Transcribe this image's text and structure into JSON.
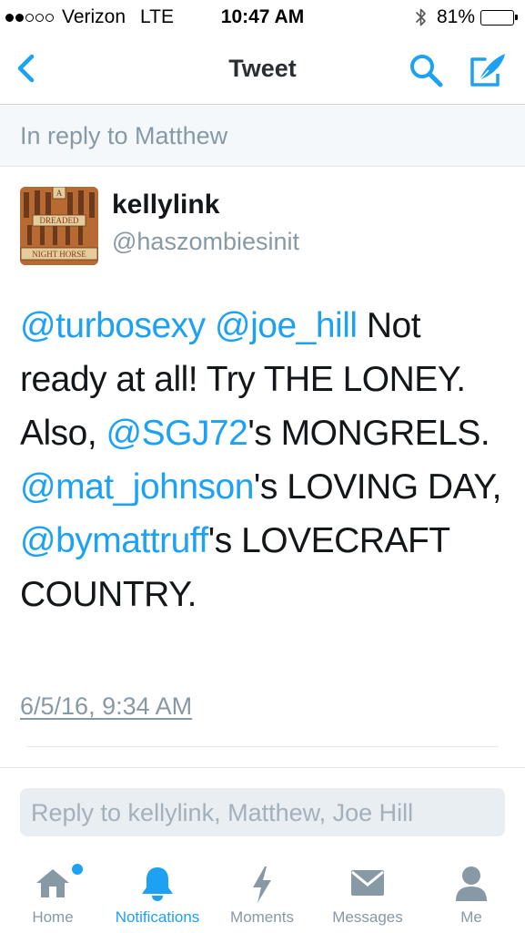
{
  "status_bar": {
    "carrier": "Verizon",
    "network": "LTE",
    "time": "10:47 AM",
    "battery": "81%",
    "battery_level": 0.81,
    "signal_bars_filled": 2,
    "signal_bars_total": 5
  },
  "nav": {
    "title": "Tweet",
    "back_icon": "chevron-left-icon",
    "search_icon": "search-icon",
    "compose_icon": "compose-icon"
  },
  "reply_context": "In reply to Matthew",
  "tweet": {
    "author_name": "kellylink",
    "author_handle": "@haszombiesinit",
    "avatar": {
      "line1": "A",
      "line2": "DREADED",
      "line3": "NIGHT HORSE",
      "background": "#b7632c"
    },
    "text_segments": [
      {
        "text": "@turbosexy",
        "mention": true
      },
      {
        "text": " ",
        "mention": false
      },
      {
        "text": "@joe_hill",
        "mention": true
      },
      {
        "text": " Not ready at all! Try THE LONEY. Also, ",
        "mention": false
      },
      {
        "text": "@SGJ72",
        "mention": true
      },
      {
        "text": "'s MONGRELS. ",
        "mention": false
      },
      {
        "text": "@mat_johnson",
        "mention": true
      },
      {
        "text": "'s LOVING DAY, ",
        "mention": false
      },
      {
        "text": "@bymattruff",
        "mention": true
      },
      {
        "text": "'s LOVECRAFT COUNTRY.",
        "mention": false
      }
    ],
    "timestamp": "6/5/16, 9:34 AM"
  },
  "reply_bar": {
    "placeholder": "Reply to kellylink, Matthew, Joe Hill"
  },
  "tabs": [
    {
      "label": "Home",
      "icon": "home-icon",
      "active": false,
      "badge": true
    },
    {
      "label": "Notifications",
      "icon": "bell-icon",
      "active": true,
      "badge": false
    },
    {
      "label": "Moments",
      "icon": "lightning-icon",
      "active": false,
      "badge": false
    },
    {
      "label": "Messages",
      "icon": "envelope-icon",
      "active": false,
      "badge": false
    },
    {
      "label": "Me",
      "icon": "person-icon",
      "active": false,
      "badge": false
    }
  ],
  "colors": {
    "accent": "#1da1f2",
    "muted": "#8899a6",
    "text": "#14171a"
  }
}
